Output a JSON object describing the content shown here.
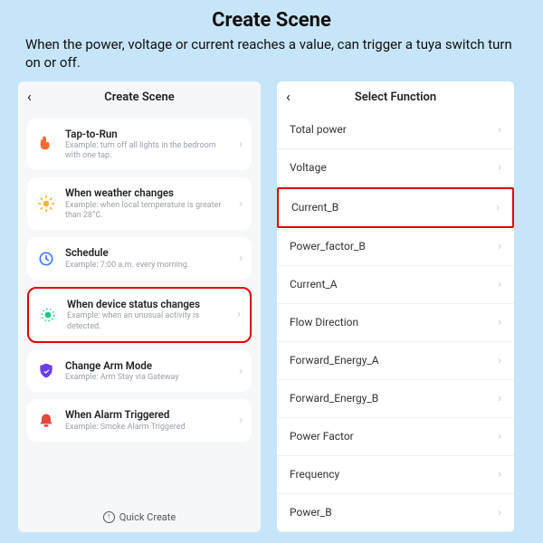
{
  "page": {
    "title": "Create Scene",
    "subtitle": "When the power, voltage or current reaches a value, can trigger a tuya switch turn on or off."
  },
  "screen_left": {
    "title": "Create Scene",
    "cards": [
      {
        "title": "Tap-to-Run",
        "sub": "Example: turn off all lights in the bedroom with one tap.",
        "highlight": false
      },
      {
        "title": "When weather changes",
        "sub": "Example: when local temperature is greater than 28°C.",
        "highlight": false
      },
      {
        "title": "Schedule",
        "sub": "Example: 7:00 a.m. every morning.",
        "highlight": false
      },
      {
        "title": "When device status changes",
        "sub": "Example: when an unusual activity is detected.",
        "highlight": true
      },
      {
        "title": "Change Arm Mode",
        "sub": "Example: Arm Stay via Gateway",
        "highlight": false
      },
      {
        "title": "When Alarm Triggered",
        "sub": "Example: Smoke Alarm Triggered",
        "highlight": false
      }
    ],
    "quick_create": "Quick Create"
  },
  "screen_right": {
    "title": "Select Function",
    "rows": [
      {
        "label": "Total power",
        "highlight": false
      },
      {
        "label": "Voltage",
        "highlight": false
      },
      {
        "label": "Current_B",
        "highlight": true
      },
      {
        "label": "Power_factor_B",
        "highlight": false
      },
      {
        "label": "Current_A",
        "highlight": false
      },
      {
        "label": "Flow Direction",
        "highlight": false
      },
      {
        "label": "Forward_Energy_A",
        "highlight": false
      },
      {
        "label": "Forward_Energy_B",
        "highlight": false
      },
      {
        "label": "Power Factor",
        "highlight": false
      },
      {
        "label": "Frequency",
        "highlight": false
      },
      {
        "label": "Power_B",
        "highlight": false
      }
    ]
  }
}
